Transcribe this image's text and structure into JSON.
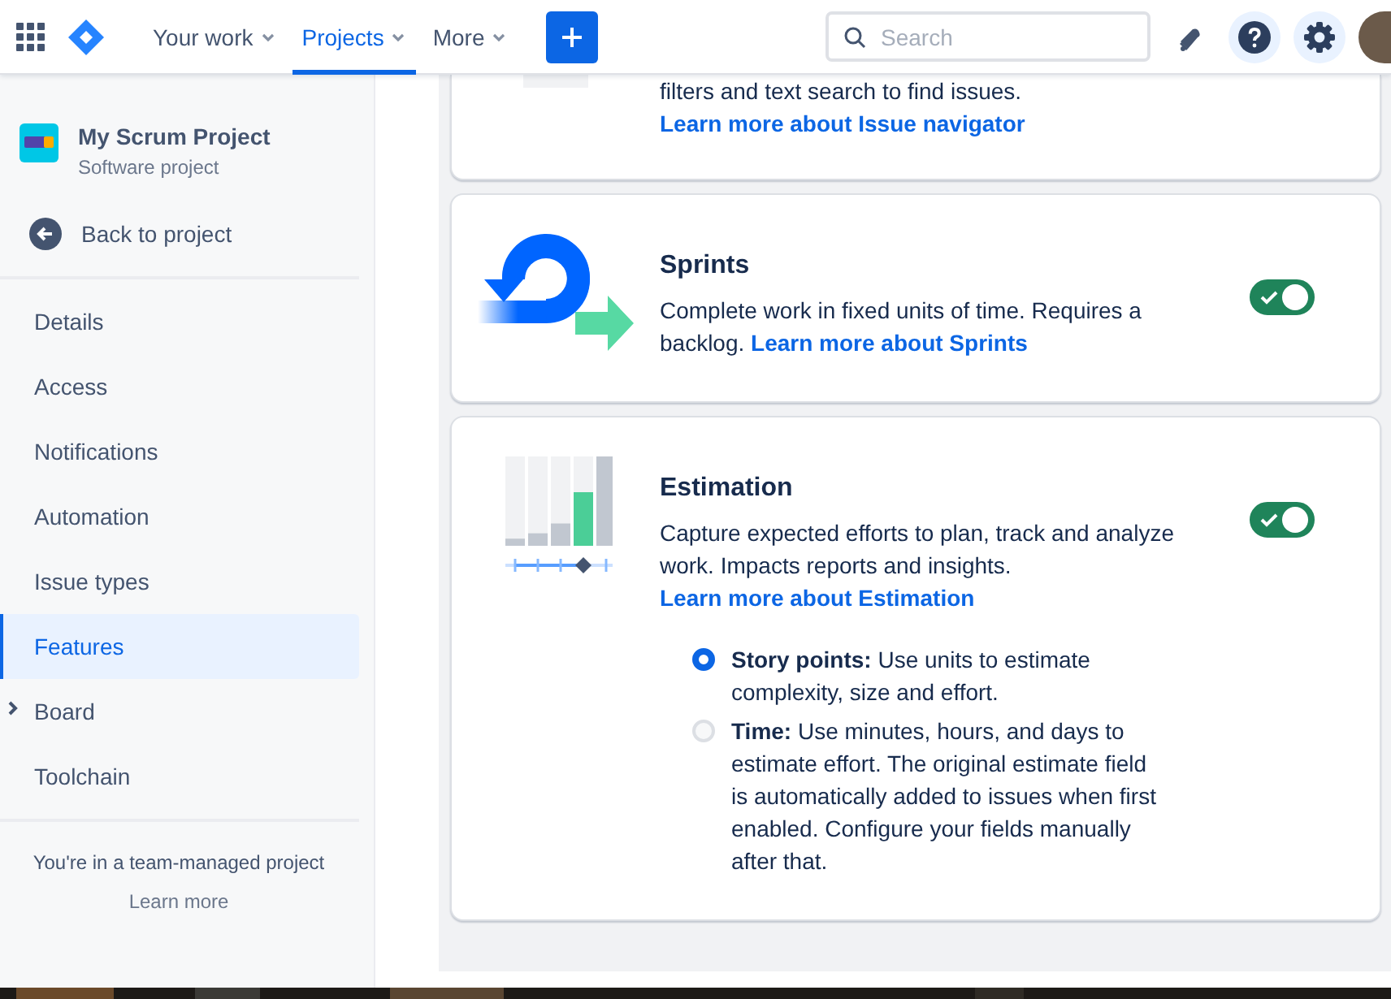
{
  "nav": {
    "items": [
      {
        "label": "Your work",
        "selected": false
      },
      {
        "label": "Projects",
        "selected": true
      },
      {
        "label": "More",
        "selected": false
      }
    ],
    "search": {
      "placeholder": "Search"
    }
  },
  "sidebar": {
    "project": {
      "name": "My Scrum Project",
      "type": "Software project"
    },
    "back": "Back to project",
    "items": [
      {
        "label": "Details",
        "selected": false,
        "expandable": false
      },
      {
        "label": "Access",
        "selected": false,
        "expandable": false
      },
      {
        "label": "Notifications",
        "selected": false,
        "expandable": false
      },
      {
        "label": "Automation",
        "selected": false,
        "expandable": false
      },
      {
        "label": "Issue types",
        "selected": false,
        "expandable": false
      },
      {
        "label": "Features",
        "selected": true,
        "expandable": false
      },
      {
        "label": "Board",
        "selected": false,
        "expandable": true
      },
      {
        "label": "Toolchain",
        "selected": false,
        "expandable": false
      }
    ],
    "footer": {
      "text": "You're in a team-managed project",
      "link": "Learn more"
    }
  },
  "features": [
    {
      "kind": "navigator",
      "description": "filters and text search to find issues.",
      "link": "Learn more about Issue navigator"
    },
    {
      "kind": "sprints",
      "title": "Sprints",
      "description": "Complete work in fixed units of time. Requires a backlog.",
      "link": "Learn more about Sprints",
      "on": true
    },
    {
      "kind": "estimation",
      "title": "Estimation",
      "description": "Capture expected efforts to plan, track and analyze work. Impacts reports and insights.",
      "link": "Learn more about Estimation",
      "on": true,
      "options": [
        {
          "text": "**Story points:** Use units to estimate complexity, size and effort.",
          "selected": true
        },
        {
          "text": "**Time:** Use minutes, hours, and days to estimate effort. The original estimate field is automatically added to issues when first enabled. Configure your fields manually after that.",
          "selected": false
        }
      ]
    }
  ]
}
